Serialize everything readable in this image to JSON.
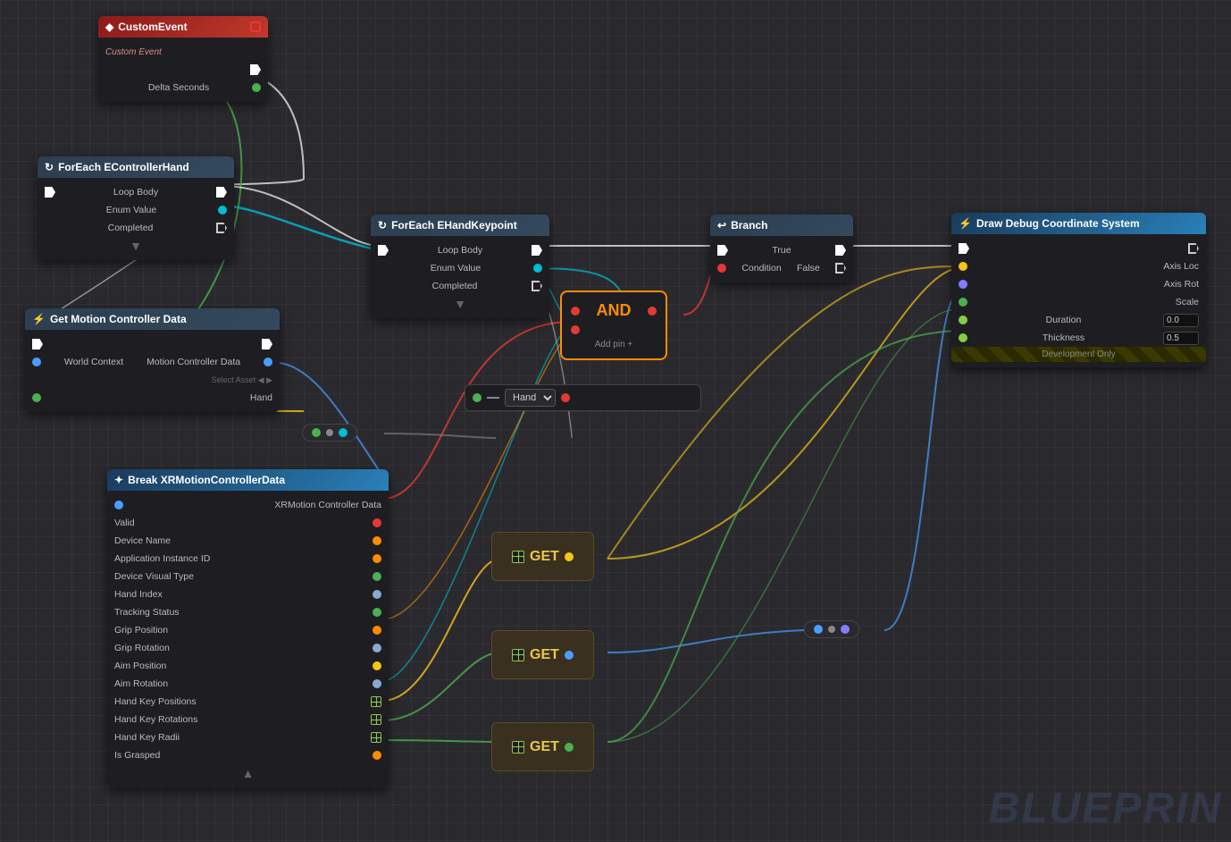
{
  "nodes": {
    "customEvent": {
      "title": "CustomEvent",
      "subtitle": "Custom Event",
      "outputs": [
        "Delta Seconds"
      ],
      "header_class": "header-red"
    },
    "forEachController": {
      "title": "ForEach EControllerHand",
      "outputs": [
        "Loop Body",
        "Enum Value",
        "Completed"
      ],
      "header_class": "header-dark"
    },
    "getMotionController": {
      "title": "Get Motion Controller Data",
      "inputs": [
        "World Context",
        "Hand"
      ],
      "outputs": [
        "Motion Controller Data"
      ],
      "header_class": "header-dark"
    },
    "forEachKeypoint": {
      "title": "ForEach EHandKeypoint",
      "outputs": [
        "Loop Body",
        "Enum Value",
        "Completed"
      ],
      "header_class": "header-dark"
    },
    "branch": {
      "title": "Branch",
      "inputs": [
        "Condition"
      ],
      "outputs": [
        "True",
        "False"
      ],
      "header_class": "header-dark"
    },
    "drawDebug": {
      "title": "Draw Debug Coordinate System",
      "inputs": [
        "Axis Loc",
        "Axis Rot",
        "Scale",
        "Duration",
        "Thickness"
      ],
      "duration_val": "0.0",
      "thickness_val": "0.5",
      "header_class": "header-blue"
    },
    "breakXR": {
      "title": "Break XRMotionControllerData",
      "input_label": "XRMotion Controller Data",
      "fields": [
        "Valid",
        "Device Name",
        "Application Instance ID",
        "Device Visual Type",
        "Hand Index",
        "Tracking Status",
        "Grip Position",
        "Grip Rotation",
        "Aim Position",
        "Aim Rotation",
        "Hand Key Positions",
        "Hand Key Rotations",
        "Hand Key Radii",
        "Is Grasped"
      ],
      "header_class": "header-blue"
    },
    "andNode": {
      "title": "AND",
      "sub": "Add pin +"
    },
    "handDropdown": {
      "options": [
        "Hand"
      ]
    },
    "get1": {
      "label": "GET"
    },
    "get2": {
      "label": "GET"
    },
    "get3": {
      "label": "GET"
    }
  },
  "watermark": "BLUEPRIN"
}
